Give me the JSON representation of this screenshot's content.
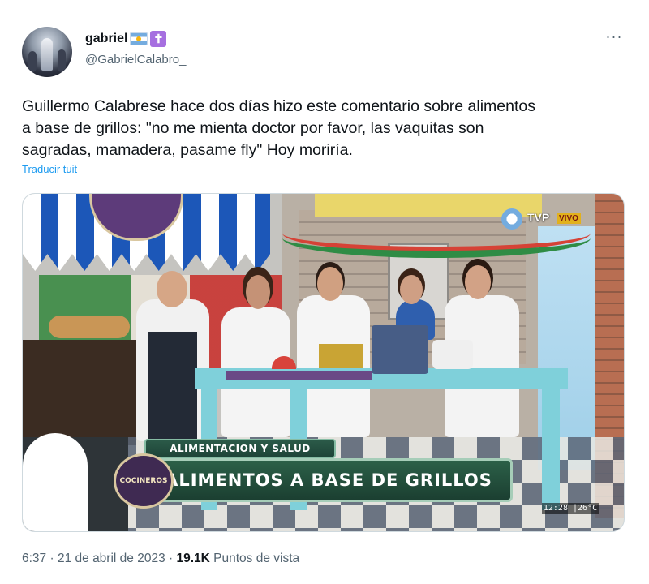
{
  "author": {
    "display_name": "gabriel",
    "badges": [
      "argentina-flag-icon",
      "latin-cross-icon"
    ],
    "cross_glyph": "✝",
    "handle": "@GabrielCalabro_"
  },
  "tweet": {
    "text": "Guillermo Calabrese hace dos días hizo este comentario sobre alimentos\na base de grillos: \"no me mienta doctor por favor, las vaquitas son\nsagradas, mamadera, pasame fly\" Hoy moriría.",
    "translate_label": "Traducir tuit"
  },
  "media": {
    "channel": "TVP",
    "live_label": "VIVO",
    "section_banner": "ALIMENTACION Y SALUD",
    "headline_banner": "ALIMENTOS A BASE DE GRILLOS",
    "show_badge": "COCINEROS",
    "clock": "12:28 |26°C"
  },
  "footer": {
    "time": "6:37",
    "separator": "·",
    "date": "21 de abril de 2023",
    "views_count": "19.1K",
    "views_label": "Puntos de vista"
  },
  "more_glyph": "···",
  "colors": {
    "link": "#1d9bf0",
    "secondary_text": "#536471",
    "primary_text": "#0f1419"
  }
}
